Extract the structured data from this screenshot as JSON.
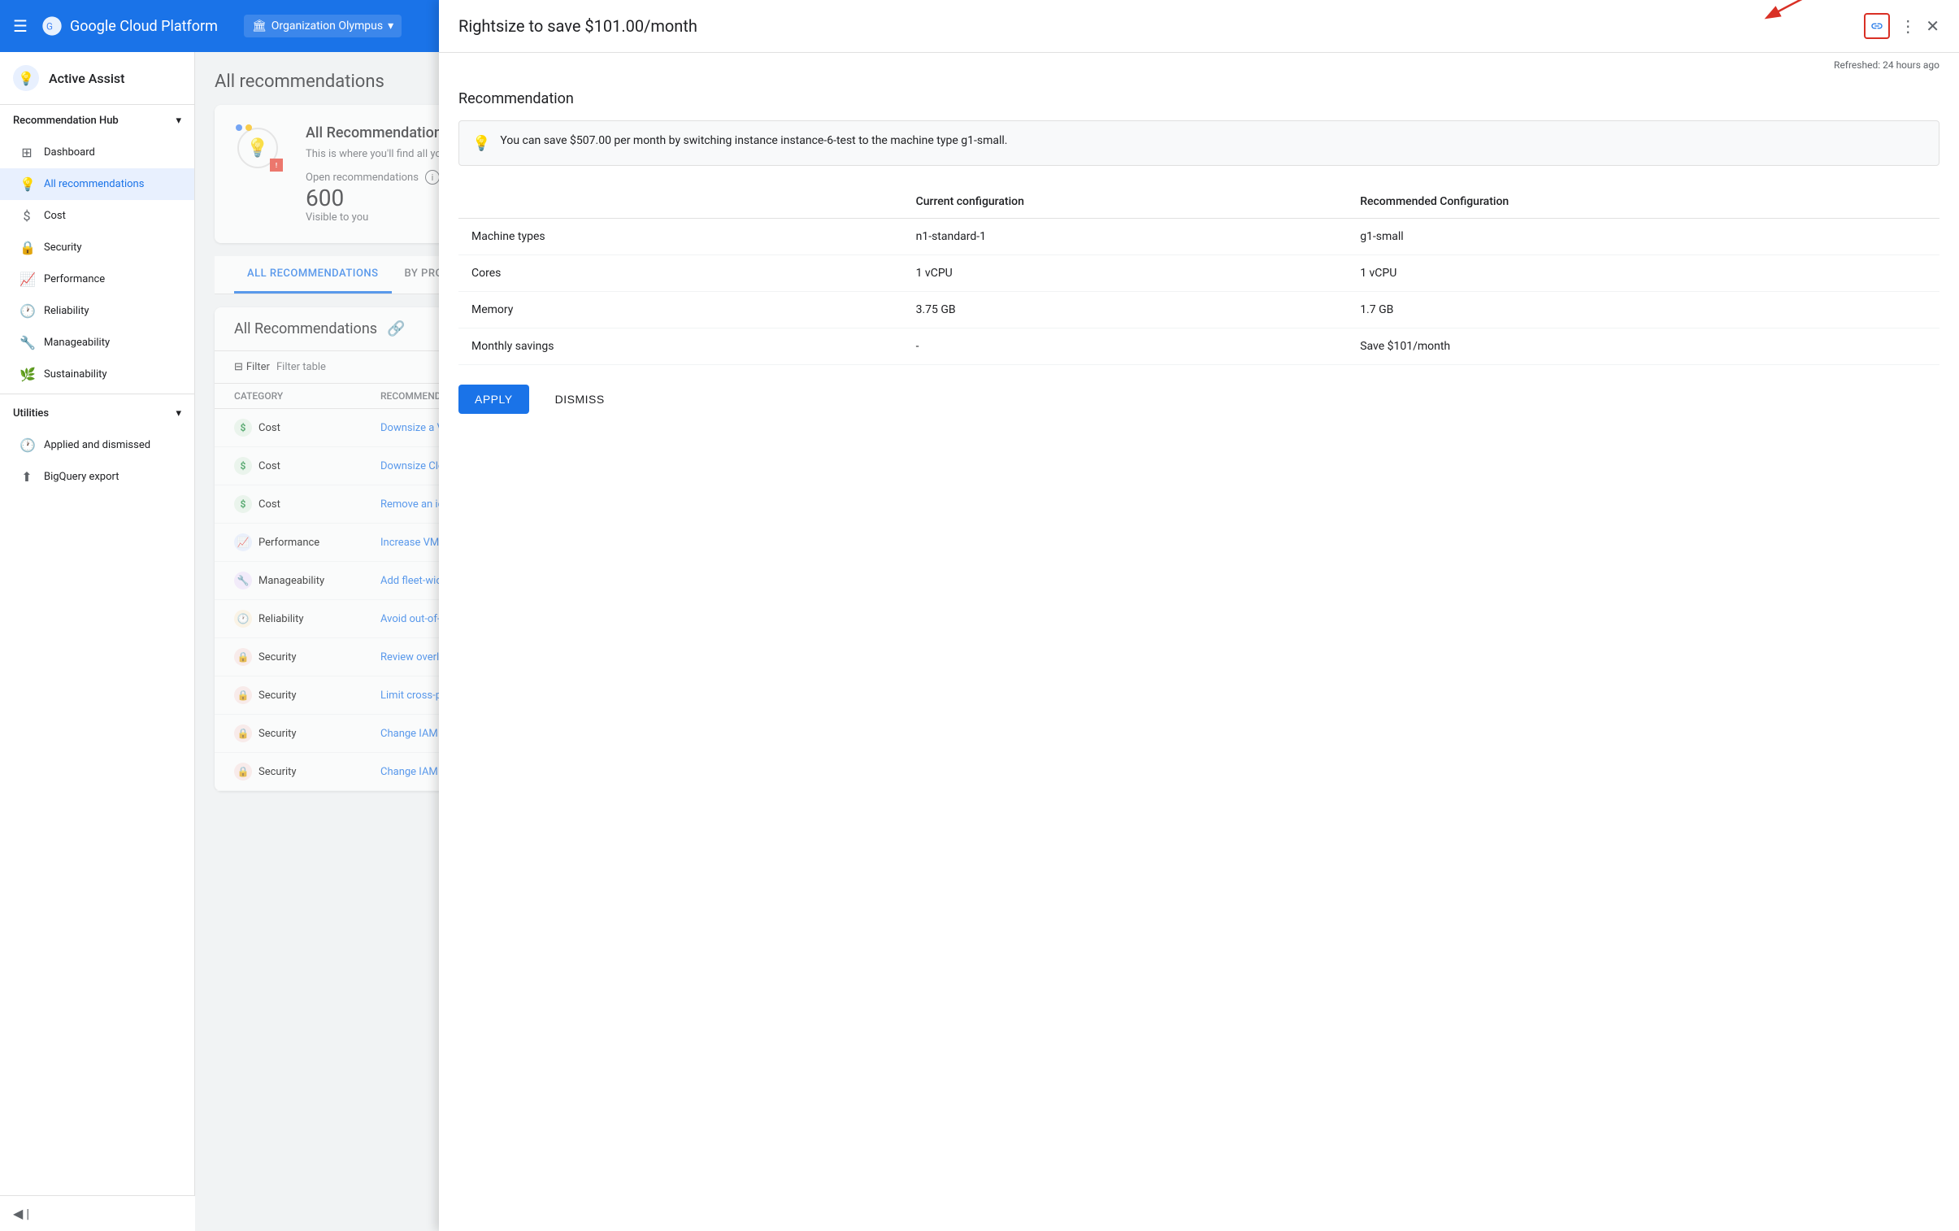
{
  "header": {
    "logo_text": "Google Cloud Platform",
    "org_name": "Organization Olympus",
    "org_icon": "🏛"
  },
  "sidebar": {
    "active_assist_label": "Active Assist",
    "recommendation_hub_label": "Recommendation Hub",
    "chevron": "▾",
    "items": [
      {
        "id": "dashboard",
        "label": "Dashboard",
        "icon": "⊞"
      },
      {
        "id": "all-recommendations",
        "label": "All recommendations",
        "icon": "💡",
        "active": true
      },
      {
        "id": "cost",
        "label": "Cost",
        "icon": "$"
      },
      {
        "id": "security",
        "label": "Security",
        "icon": "🔒"
      },
      {
        "id": "performance",
        "label": "Performance",
        "icon": "📈"
      },
      {
        "id": "reliability",
        "label": "Reliability",
        "icon": "🕐"
      },
      {
        "id": "manageability",
        "label": "Manageability",
        "icon": "🔧"
      },
      {
        "id": "sustainability",
        "label": "Sustainability",
        "icon": "🌿"
      }
    ],
    "utilities_label": "Utilities",
    "utility_items": [
      {
        "id": "applied-dismissed",
        "label": "Applied and dismissed",
        "icon": "🕐"
      },
      {
        "id": "bigquery-export",
        "label": "BigQuery export",
        "icon": "⬆"
      }
    ],
    "collapse_label": "◀ |"
  },
  "main": {
    "page_title": "All recommendations",
    "card": {
      "title": "All Recommendations",
      "description": "This is where you'll find all your re... don't have the correct IAM permiss...",
      "open_recs_label": "Open recommendations",
      "open_recs_info_icon": "i",
      "open_recs_count": "600",
      "visible_label": "Visible to you",
      "dot_colors": [
        "#4285f4",
        "#fbbc04",
        "#ea4335"
      ]
    },
    "tabs": [
      {
        "id": "all-recommendations",
        "label": "ALL RECOMMENDATIONS",
        "active": true
      },
      {
        "id": "by-product",
        "label": "BY PRODUCT"
      }
    ],
    "all_recs_section": {
      "title": "All Recommendations",
      "link_icon": "🔗",
      "filter_label": "Filter",
      "filter_table_label": "Filter table",
      "columns": [
        "Category",
        "Recommendation"
      ],
      "rows": [
        {
          "category": "Cost",
          "badge_type": "cost",
          "badge_char": "$",
          "recommendation": "Downsize a VM"
        },
        {
          "category": "Cost",
          "badge_type": "cost",
          "badge_char": "$",
          "recommendation": "Downsize Cloud SQL ins..."
        },
        {
          "category": "Cost",
          "badge_type": "cost",
          "badge_char": "$",
          "recommendation": "Remove an idle disk"
        },
        {
          "category": "Performance",
          "badge_type": "perf",
          "badge_char": "📈",
          "recommendation": "Increase VM performan..."
        },
        {
          "category": "Manageability",
          "badge_type": "manage",
          "badge_char": "🔧",
          "recommendation": "Add fleet-wide monitori..."
        },
        {
          "category": "Reliability",
          "badge_type": "reliability",
          "badge_char": "🕐",
          "recommendation": "Avoid out-of-disk issues..."
        },
        {
          "category": "Security",
          "badge_type": "security",
          "badge_char": "🔒",
          "recommendation": "Review overly permissiv..."
        },
        {
          "category": "Security",
          "badge_type": "security",
          "badge_char": "🔒",
          "recommendation": "Limit cross-project impe..."
        },
        {
          "category": "Security",
          "badge_type": "security",
          "badge_char": "🔒",
          "recommendation": "Change IAM role grants..."
        },
        {
          "category": "Security",
          "badge_type": "security",
          "badge_char": "🔒",
          "recommendation": "Change IAM role grants..."
        }
      ]
    }
  },
  "detail_panel": {
    "title": "Rightsize to save $101.00/month",
    "refreshed_text": "Refreshed: 24 hours ago",
    "section_title": "Recommendation",
    "info_text": "You can save $507.00 per month by switching instance instance-6-test to the machine type g1-small.",
    "config_table": {
      "col1_header": "",
      "col2_header": "Current configuration",
      "col3_header": "Recommended Configuration",
      "rows": [
        {
          "label": "Machine types",
          "current": "n1-standard-1",
          "recommended": "g1-small"
        },
        {
          "label": "Cores",
          "current": "1 vCPU",
          "recommended": "1 vCPU"
        },
        {
          "label": "Memory",
          "current": "3.75 GB",
          "recommended": "1.7 GB"
        },
        {
          "label": "Monthly savings",
          "current": "-",
          "recommended": "Save $101/month"
        }
      ]
    },
    "apply_label": "APPLY",
    "dismiss_label": "DISMISS"
  }
}
